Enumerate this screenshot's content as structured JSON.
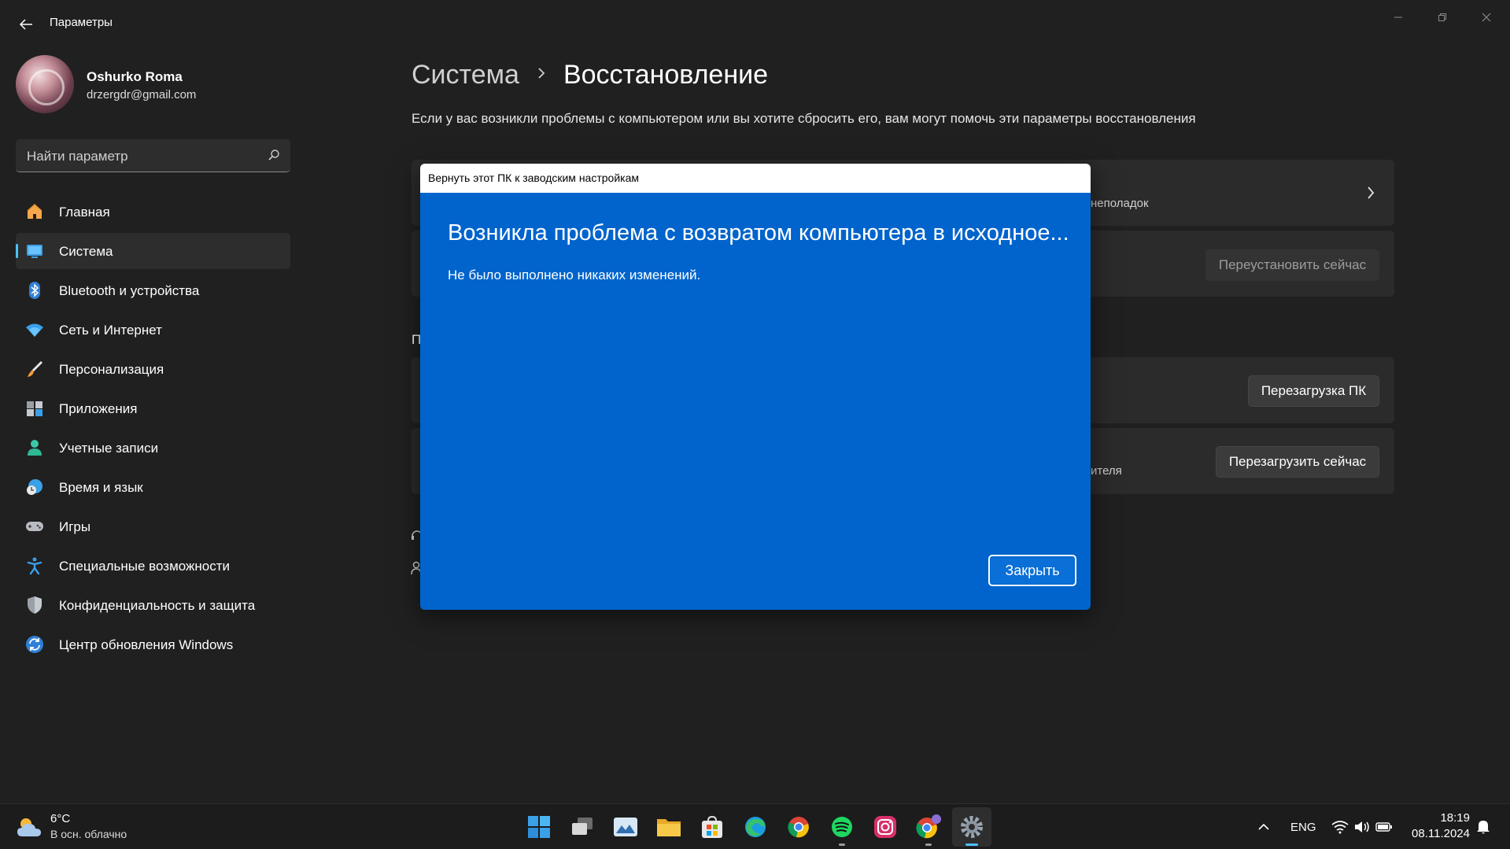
{
  "window": {
    "title": "Параметры",
    "controls": [
      "minimize",
      "maximize",
      "close"
    ]
  },
  "profile": {
    "name": "Oshurko Roma",
    "email": "drzergdr@gmail.com"
  },
  "search": {
    "placeholder": "Найти параметр"
  },
  "sidebar": {
    "items": [
      {
        "label": "Главная",
        "icon": "home-icon"
      },
      {
        "label": "Система",
        "icon": "system-icon",
        "active": true
      },
      {
        "label": "Bluetooth и устройства",
        "icon": "bluetooth-icon"
      },
      {
        "label": "Сеть и Интернет",
        "icon": "wifi-icon"
      },
      {
        "label": "Персонализация",
        "icon": "brush-icon"
      },
      {
        "label": "Приложения",
        "icon": "apps-icon"
      },
      {
        "label": "Учетные записи",
        "icon": "account-icon"
      },
      {
        "label": "Время и язык",
        "icon": "time-language-icon"
      },
      {
        "label": "Игры",
        "icon": "gamepad-icon"
      },
      {
        "label": "Специальные возможности",
        "icon": "accessibility-icon"
      },
      {
        "label": "Конфиденциальность и защита",
        "icon": "shield-icon"
      },
      {
        "label": "Центр обновления Windows",
        "icon": "update-icon"
      }
    ]
  },
  "main": {
    "breadcrumb_parent": "Система",
    "breadcrumb_current": "Восстановление",
    "description": "Если у вас возникли проблемы с компьютером или вы хотите сбросить его, вам могут помочь эти параметры восстановления",
    "card1_partial_text": "неполадок",
    "reinstall_button": "Переустановить сейчас",
    "section_partial_letter": "П",
    "restart_pc_button": "Перезагрузка ПК",
    "card4_partial_text": "ителя",
    "restart_now_button": "Перезагрузить сейчас"
  },
  "dialog": {
    "title": "Вернуть этот ПК к заводским настройкам",
    "heading": "Возникла проблема с возвратом компьютера в исходное...",
    "message": "Не было выполнено никаких изменений.",
    "close_button": "Закрыть",
    "background_color": "#0064CC"
  },
  "taskbar": {
    "weather_temp": "6°C",
    "weather_condition": "В осн. облачно",
    "apps": [
      "start-icon",
      "task-view-icon",
      "photos-icon",
      "file-explorer-icon",
      "microsoft-store-icon",
      "edge-icon",
      "chrome-icon",
      "spotify-icon",
      "instagram-icon",
      "chrome-profile-icon",
      "settings-icon"
    ],
    "language": "ENG",
    "time": "18:19",
    "date": "08.11.2024"
  },
  "colors": {
    "accent": "#4CC2FF",
    "background": "#202020",
    "card": "#2B2B2B"
  }
}
